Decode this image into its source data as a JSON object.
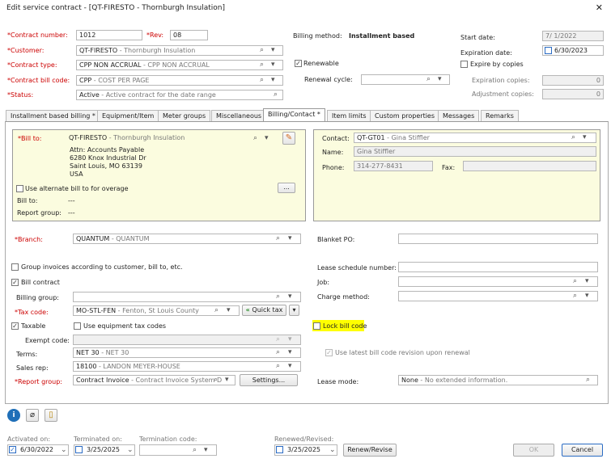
{
  "window": {
    "title": "Edit service contract - [QT-FIRESTO - Thornburgh Insulation]",
    "close": "✕"
  },
  "header": {
    "contract_number_label": "*Contract number:",
    "contract_number": "1012",
    "rev_label": "*Rev:",
    "rev": "08",
    "customer_label": "*Customer:",
    "customer_code": "QT-FIRESTO",
    "customer_name": "- Thornburgh Insulation",
    "contract_type_label": "*Contract type:",
    "contract_type_code": "CPP NON ACCRUAL",
    "contract_type_name": "- CPP NON ACCRUAL",
    "bill_code_label": "*Contract bill code:",
    "bill_code_code": "CPP",
    "bill_code_name": "- COST PER PAGE",
    "status_label": "*Status:",
    "status_code": "Active",
    "status_name": "- Active contract for the date range",
    "billing_method_label": "Billing method:",
    "billing_method": "Installment based",
    "renewable_label": "Renewable",
    "renewal_cycle_label": "Renewal cycle:",
    "start_date_label": "Start date:",
    "start_date": "7/  1/2022",
    "expiration_date_label": "Expiration date:",
    "expiration_date": "6/30/2023",
    "expire_by_copies_label": "Expire by copies",
    "expiration_copies_label": "Expiration copies:",
    "expiration_copies": "0",
    "adjustment_copies_label": "Adjustment copies:",
    "adjustment_copies": "0"
  },
  "tabs": [
    "Installment based billing *",
    "Equipment/Item",
    "Meter groups",
    "Miscellaneous",
    "Billing/Contact *",
    "Item limits",
    "Custom properties",
    "Messages",
    "Remarks"
  ],
  "bill_to": {
    "label": "*Bill to:",
    "code": "QT-FIRESTO",
    "name": "- Thornburgh Insulation",
    "addr1": "Attn: Accounts Payable",
    "addr2": "6280 Knox Industrial Dr",
    "addr3": "Saint Louis, MO 63139",
    "addr4": "USA",
    "alt_label": "Use alternate bill to for overage",
    "more": "...",
    "bill_to2_label": "Bill to:",
    "bill_to2": "---",
    "report_group_label": "Report group:",
    "report_group": "---"
  },
  "contact": {
    "contact_label": "Contact:",
    "code": "QT-GT01",
    "name": "- Gina Stiffler",
    "name_label": "Name:",
    "name_value": "Gina Stiffler",
    "phone_label": "Phone:",
    "phone": "314-277-8431",
    "fax_label": "Fax:"
  },
  "billing": {
    "branch_label": "*Branch:",
    "branch_code": "QUANTUM",
    "branch_name": "- QUANTUM",
    "blanket_po_label": "Blanket PO:",
    "group_invoices_label": "Group invoices according to customer, bill to, etc.",
    "lease_schedule_label": "Lease schedule number:",
    "bill_contract_label": "Bill contract",
    "job_label": "Job:",
    "billing_group_label": "Billing group:",
    "charge_method_label": "Charge method:",
    "tax_code_label": "*Tax code:",
    "tax_code": "MO-STL-FEN",
    "tax_name": "- Fenton, St Louis County",
    "quick_tax": "Quick tax",
    "taxable_label": "Taxable",
    "use_equipment_tax_label": "Use equipment tax codes",
    "lock_bill_code_label": "Lock bill code",
    "exempt_code_label": "Exempt code:",
    "terms_label": "Terms:",
    "terms_code": "NET 30",
    "terms_name": "- NET 30",
    "use_latest_label": "Use latest bill code revision upon renewal",
    "sales_rep_label": "Sales rep:",
    "sales_rep_code": "18100",
    "sales_rep_name": "- LANDON  MEYER-HOUSE",
    "report_group_label": "*Report group:",
    "report_group_code": "Contract Invoice",
    "report_group_name": "- Contract Invoice System D",
    "settings": "Settings...",
    "lease_mode_label": "Lease mode:",
    "lease_mode_code": "None",
    "lease_mode_name": "- No extended information."
  },
  "footer": {
    "activated_label": "Activated on:",
    "activated": "6/30/2022",
    "terminated_label": "Terminated on:",
    "terminated": "3/25/2025",
    "termination_code_label": "Termination code:",
    "renewed_label": "Renewed/Revised:",
    "renewed": "3/25/2025",
    "renew_button": "Renew/Revise",
    "ok": "OK",
    "cancel": "Cancel"
  },
  "colors": {
    "panel_bg": "#fbfcdf",
    "highlight": "#ffff00",
    "accent": "#2b6cc4",
    "required": "#cc0000"
  }
}
